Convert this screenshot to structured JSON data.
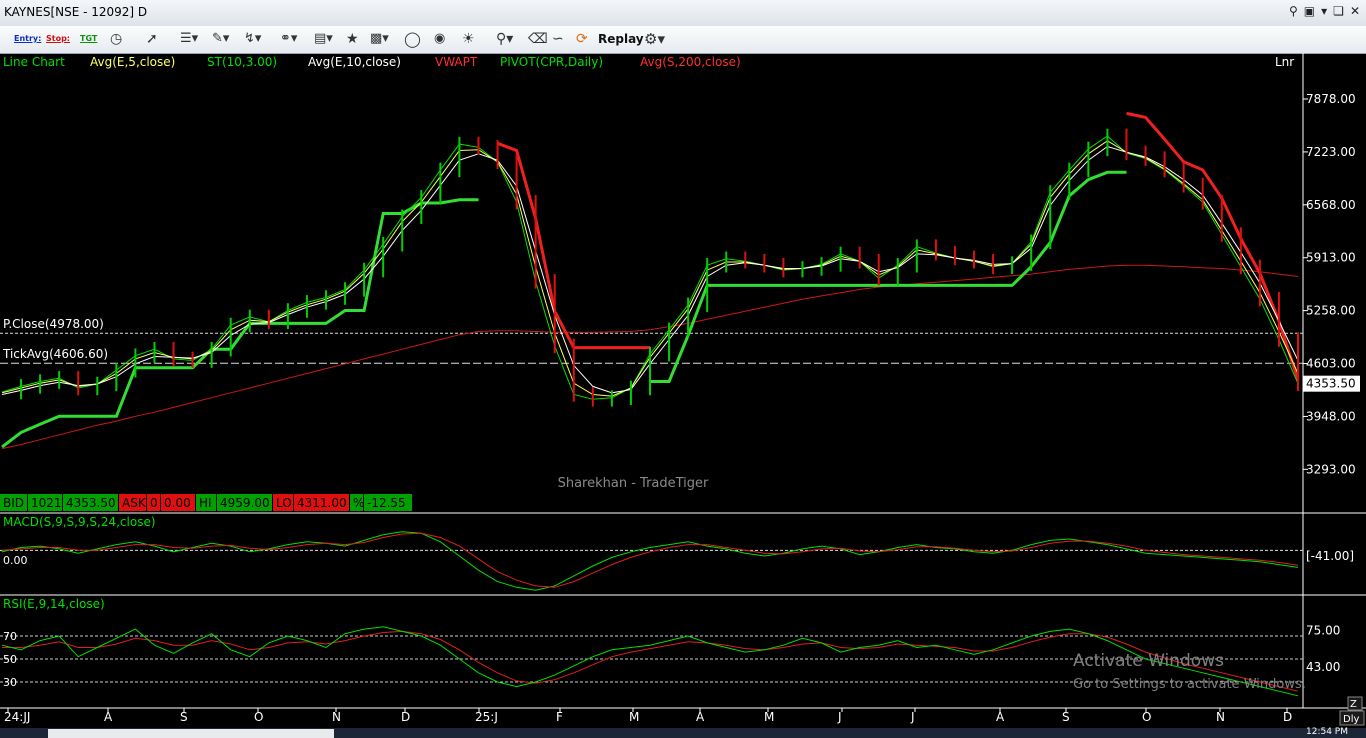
{
  "window": {
    "title": "KAYNES[NSE - 12092] D"
  },
  "toolbar": {
    "entry_label": "Entry:",
    "stop_label": "Stop:",
    "tgt_label": "TGT",
    "replay_label": "Replay"
  },
  "legend": [
    {
      "text": "Line Chart",
      "color": "#00e000"
    },
    {
      "text": "Avg(E,5,close)",
      "color": "#ffff66"
    },
    {
      "text": "ST(10,3.00)",
      "color": "#00e000"
    },
    {
      "text": "Avg(E,10,close)",
      "color": "#ffffff"
    },
    {
      "text": "VWAPT",
      "color": "#ff3030"
    },
    {
      "text": "PIVOT(CPR,Daily)",
      "color": "#00e000"
    },
    {
      "text": "Avg(S,200,close)",
      "color": "#ff3030"
    }
  ],
  "scale_mode": "Lnr",
  "chart_data": {
    "type": "line",
    "title": "KAYNES[NSE - 12092] D",
    "price_axis_ticks": [
      7878.0,
      7223.0,
      6568.0,
      5913.0,
      5258.0,
      4603.0,
      3948.0,
      3293.0
    ],
    "last_price_label": "4353.50",
    "ref_lines": [
      {
        "label": "P.Close(4978.00)",
        "value": 4978.0
      },
      {
        "label": "TickAvg(4606.60)",
        "value": 4606.6
      }
    ],
    "x_ticks": [
      "24:JJ",
      "A",
      "S",
      "O",
      "N",
      "D",
      "25:J",
      "F",
      "M",
      "A",
      "M",
      "J",
      "J",
      "A",
      "S",
      "O",
      "N",
      "D"
    ],
    "series": [
      {
        "name": "close",
        "color": "#00e000",
        "values": [
          4250,
          4320,
          4380,
          4420,
          4300,
          4350,
          4520,
          4700,
          4780,
          4660,
          4640,
          4780,
          5080,
          5180,
          5120,
          5260,
          5360,
          5420,
          5520,
          5760,
          6080,
          6420,
          6660,
          7000,
          7320,
          7280,
          7100,
          6600,
          5620,
          4820,
          4220,
          4160,
          4180,
          4300,
          4720,
          5020,
          5330,
          5820,
          5900,
          5870,
          5820,
          5760,
          5780,
          5830,
          5960,
          5870,
          5660,
          5820,
          6050,
          5970,
          5910,
          5870,
          5800,
          5840,
          6110,
          6720,
          7000,
          7260,
          7420,
          7210,
          7140,
          7000,
          6810,
          6600,
          6200,
          5800,
          5400,
          4900,
          4353.5
        ]
      },
      {
        "name": "Avg(E,5,close)",
        "color": "#ffff66",
        "values": [
          4240,
          4300,
          4360,
          4400,
          4320,
          4350,
          4480,
          4660,
          4740,
          4680,
          4660,
          4760,
          5020,
          5140,
          5120,
          5240,
          5330,
          5400,
          5500,
          5720,
          6020,
          6360,
          6600,
          6920,
          7240,
          7250,
          7100,
          6700,
          5800,
          4980,
          4360,
          4220,
          4200,
          4300,
          4680,
          4980,
          5280,
          5760,
          5860,
          5860,
          5820,
          5770,
          5780,
          5820,
          5930,
          5870,
          5700,
          5800,
          6010,
          5960,
          5910,
          5870,
          5810,
          5840,
          6080,
          6660,
          6950,
          7200,
          7360,
          7220,
          7150,
          7010,
          6830,
          6630,
          6250,
          5870,
          5480,
          5000,
          4480
        ]
      },
      {
        "name": "Avg(E,10,close)",
        "color": "#ffffff",
        "values": [
          4220,
          4270,
          4330,
          4370,
          4330,
          4350,
          4440,
          4600,
          4690,
          4680,
          4670,
          4740,
          4950,
          5090,
          5110,
          5210,
          5300,
          5370,
          5460,
          5650,
          5930,
          6250,
          6500,
          6810,
          7120,
          7200,
          7120,
          6800,
          6000,
          5200,
          4580,
          4320,
          4240,
          4280,
          4600,
          4900,
          5200,
          5680,
          5820,
          5850,
          5820,
          5780,
          5780,
          5810,
          5900,
          5870,
          5740,
          5790,
          5960,
          5950,
          5910,
          5880,
          5830,
          5840,
          6030,
          6560,
          6870,
          7120,
          7290,
          7220,
          7160,
          7040,
          6880,
          6690,
          6340,
          5980,
          5600,
          5130,
          4640
        ]
      },
      {
        "name": "ST(10,3.00)",
        "color": "#33dd33",
        "values": [
          3570,
          3750,
          3850,
          3950,
          3950,
          3950,
          3950,
          4550,
          4550,
          4550,
          4550,
          4780,
          4780,
          5100,
          5100,
          5100,
          5100,
          5100,
          5260,
          5260,
          6460,
          6460,
          6590,
          6590,
          6630,
          6630,
          null,
          null,
          null,
          null,
          null,
          null,
          null,
          null,
          4380,
          4380,
          4950,
          5570,
          5570,
          5570,
          5570,
          5570,
          5570,
          5570,
          5570,
          5570,
          5570,
          5570,
          5570,
          5570,
          5570,
          5570,
          5570,
          5570,
          5800,
          6100,
          6680,
          6880,
          6970,
          6970,
          null,
          null,
          null,
          null,
          null,
          null,
          null,
          null,
          null
        ]
      },
      {
        "name": "VWAPT",
        "color": "#ee2020",
        "values": [
          null,
          null,
          null,
          null,
          null,
          null,
          null,
          null,
          null,
          null,
          null,
          null,
          null,
          null,
          null,
          null,
          null,
          null,
          null,
          null,
          null,
          null,
          null,
          null,
          null,
          null,
          7330,
          7240,
          6400,
          5250,
          4800,
          4800,
          4800,
          4800,
          4800,
          null,
          null,
          null,
          null,
          null,
          null,
          null,
          null,
          null,
          null,
          null,
          null,
          null,
          null,
          null,
          null,
          null,
          null,
          null,
          null,
          null,
          null,
          null,
          null,
          7700,
          7650,
          7380,
          7100,
          7000,
          6650,
          6150,
          5720,
          5130,
          4400
        ]
      },
      {
        "name": "Avg(S,200,close)",
        "color": "#cc1818",
        "values": [
          3550,
          3600,
          3660,
          3720,
          3780,
          3840,
          3890,
          3950,
          4000,
          4060,
          4120,
          4180,
          4240,
          4300,
          4360,
          4420,
          4480,
          4540,
          4600,
          4660,
          4720,
          4780,
          4840,
          4900,
          4960,
          5000,
          5010,
          5010,
          5000,
          4990,
          4990,
          4990,
          4995,
          5000,
          5020,
          5060,
          5100,
          5150,
          5200,
          5250,
          5300,
          5350,
          5400,
          5440,
          5480,
          5520,
          5550,
          5570,
          5590,
          5610,
          5630,
          5650,
          5670,
          5690,
          5710,
          5740,
          5770,
          5790,
          5810,
          5820,
          5820,
          5810,
          5800,
          5790,
          5780,
          5760,
          5740,
          5710,
          5680
        ]
      }
    ],
    "y_range": [
      3000,
      8200
    ],
    "status_bar": [
      {
        "label": "BID",
        "bg": "#00a000"
      },
      {
        "label": "1021",
        "bg": "#00a000"
      },
      {
        "label": "4353.50",
        "bg": "#00a000"
      },
      {
        "label": "ASK",
        "bg": "#e01010"
      },
      {
        "label": "0",
        "bg": "#e01010"
      },
      {
        "label": "0.00",
        "bg": "#e01010"
      },
      {
        "label": "HI",
        "bg": "#00a000"
      },
      {
        "label": "4959.00",
        "bg": "#00a000"
      },
      {
        "label": "LO",
        "bg": "#e01010"
      },
      {
        "label": "4311.00",
        "bg": "#e01010"
      },
      {
        "label": "%",
        "bg": "#00a000"
      },
      {
        "label": "-12.55",
        "bg": "#00a000"
      }
    ],
    "watermark": "Sharekhan - TradeTiger",
    "macd": {
      "label": "MACD(S,9,S,9,S,24,close)",
      "left_value": "0.00",
      "right_value": "[-41.00]",
      "range": [
        -300,
        150
      ],
      "series": [
        {
          "name": "MACD",
          "color": "#00e000",
          "values": [
            -10,
            20,
            30,
            10,
            -20,
            10,
            40,
            60,
            30,
            -10,
            20,
            50,
            30,
            -10,
            10,
            40,
            60,
            50,
            30,
            70,
            110,
            130,
            120,
            60,
            -40,
            -140,
            -220,
            -260,
            -280,
            -250,
            -180,
            -110,
            -50,
            -10,
            20,
            40,
            60,
            30,
            10,
            -20,
            -40,
            -20,
            10,
            30,
            10,
            -30,
            -10,
            20,
            40,
            20,
            10,
            -10,
            -20,
            0,
            40,
            70,
            80,
            60,
            40,
            10,
            -20,
            -30,
            -40,
            -50,
            -60,
            -70,
            -80,
            -100,
            -120
          ]
        },
        {
          "name": "Signal",
          "color": "#dd2020",
          "values": [
            0,
            10,
            20,
            20,
            0,
            0,
            20,
            40,
            40,
            20,
            15,
            30,
            35,
            15,
            5,
            20,
            40,
            50,
            40,
            55,
            90,
            115,
            120,
            90,
            30,
            -60,
            -150,
            -210,
            -250,
            -260,
            -220,
            -160,
            -100,
            -50,
            -10,
            20,
            40,
            40,
            20,
            0,
            -20,
            -25,
            -10,
            10,
            15,
            -5,
            -10,
            5,
            25,
            25,
            15,
            0,
            -10,
            -5,
            20,
            50,
            65,
            65,
            50,
            30,
            0,
            -15,
            -30,
            -40,
            -50,
            -60,
            -70,
            -85,
            -105
          ]
        }
      ]
    },
    "rsi": {
      "label": "RSI(E,9,14,close)",
      "left_ticks": [
        70,
        50,
        30
      ],
      "right_ticks": [
        "75.00",
        "43.00"
      ],
      "range": [
        10,
        90
      ],
      "series": [
        {
          "name": "RSI",
          "color": "#00e000",
          "values": [
            62,
            58,
            66,
            70,
            52,
            60,
            68,
            76,
            62,
            55,
            64,
            72,
            58,
            52,
            64,
            70,
            66,
            60,
            72,
            76,
            78,
            74,
            70,
            62,
            50,
            38,
            30,
            26,
            30,
            36,
            44,
            52,
            58,
            60,
            62,
            66,
            70,
            64,
            60,
            56,
            58,
            62,
            68,
            64,
            56,
            60,
            62,
            66,
            60,
            62,
            58,
            54,
            58,
            64,
            70,
            74,
            76,
            72,
            66,
            58,
            50,
            46,
            42,
            38,
            34,
            30,
            26,
            22,
            18
          ]
        },
        {
          "name": "Signal",
          "color": "#dd2020",
          "values": [
            60,
            60,
            62,
            65,
            60,
            60,
            63,
            68,
            66,
            62,
            62,
            66,
            63,
            58,
            60,
            64,
            65,
            63,
            66,
            70,
            73,
            74,
            72,
            67,
            58,
            47,
            38,
            31,
            29,
            32,
            38,
            45,
            52,
            56,
            59,
            62,
            65,
            64,
            62,
            59,
            58,
            60,
            63,
            64,
            60,
            59,
            60,
            63,
            62,
            61,
            60,
            57,
            57,
            60,
            65,
            69,
            72,
            72,
            69,
            63,
            56,
            51,
            46,
            42,
            38,
            34,
            30,
            26,
            22
          ]
        }
      ]
    }
  },
  "activation": {
    "title": "Activate Windows",
    "subtitle": "Go to Settings to activate Windows."
  },
  "taskbar": {
    "clock": "12:54 PM"
  }
}
